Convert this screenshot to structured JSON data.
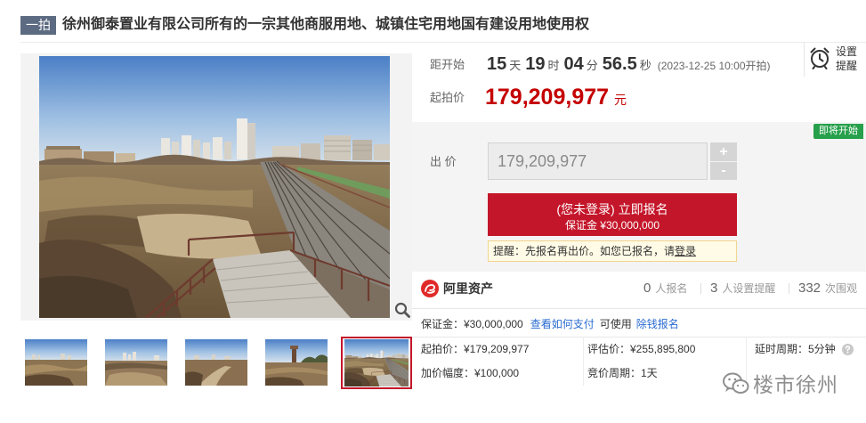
{
  "header": {
    "badge": "一拍",
    "title": "徐州御泰置业有限公司所有的一宗其他商服用地、城镇住宅用地国有建设用地使用权"
  },
  "countdown": {
    "label": "距开始",
    "days": "15",
    "days_unit": "天",
    "hours": "19",
    "hours_unit": "时",
    "minutes": "04",
    "minutes_unit": "分",
    "seconds": "56.5",
    "seconds_unit": "秒",
    "start_note": "(2023-12-25 10:00开拍)"
  },
  "reminder": {
    "line1": "设置",
    "line2": "提醒",
    "icon": "alarm-clock-icon"
  },
  "starting_price": {
    "label": "起拍价",
    "value": "179,209,977",
    "unit": "元"
  },
  "bid_panel": {
    "status_badge": "即将开始",
    "bid_label": "出 价",
    "bid_value": "179,209,977",
    "plus": "+",
    "minus": "-",
    "register_button": {
      "line1": "(您未登录) 立即报名",
      "line2": "保证金 ¥30,000,000"
    },
    "notice": {
      "text": "提醒：先报名再出价。如您已报名，请",
      "link": "登录"
    }
  },
  "platform": {
    "logo_text": "阿里资产",
    "logo_icon": "alibaba-asset-logo-icon",
    "stats": [
      {
        "count": "0",
        "label": "人报名"
      },
      {
        "count": "3",
        "label": "人设置提醒"
      },
      {
        "count": "332",
        "label": "次围观"
      }
    ]
  },
  "deposit_row": {
    "deposit": "保证金：¥30,000,000",
    "how_to_pay_link": "查看如何支付",
    "available_text": "可使用",
    "credit_link": "除钱报名"
  },
  "details": {
    "row1": [
      "起拍价：¥179,209,977",
      "评估价：¥255,895,800",
      "延时周期：5分钟"
    ],
    "row2": [
      "加价幅度：¥100,000",
      "竞价周期：1天"
    ]
  },
  "gallery": {
    "selected_thumbnail_index": 4,
    "zoom_icon": "magnifier-icon"
  },
  "watermark": {
    "text": "楼市徐州",
    "icon": "wechat-icon"
  },
  "colors": {
    "accent_red": "#c4162a",
    "price_red": "#c40000",
    "link_blue": "#2a6bd1",
    "status_green": "#27a04b",
    "round_badge": "#5d6b82"
  }
}
